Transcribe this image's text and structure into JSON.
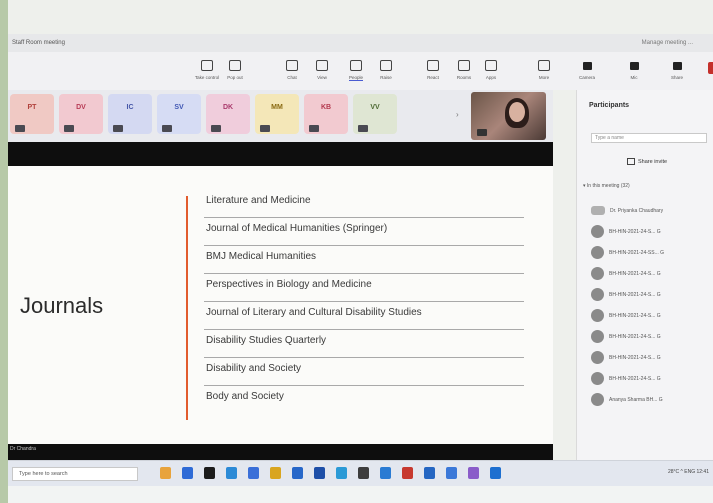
{
  "window": {
    "title": "Staff Room meeting",
    "right_text": "Manage meeting  ..."
  },
  "toolbar": {
    "items": [
      {
        "label": "Take control",
        "icon": "screen-icon"
      },
      {
        "label": "Pop out",
        "icon": "popout-icon"
      },
      {
        "label": "Chat",
        "icon": "chat-icon"
      },
      {
        "label": "View",
        "icon": "view-icon"
      },
      {
        "label": "People",
        "icon": "people-icon",
        "active": true
      },
      {
        "label": "Raise",
        "icon": "hand-icon"
      },
      {
        "label": "React",
        "icon": "react-icon"
      },
      {
        "label": "Rooms",
        "icon": "rooms-icon"
      },
      {
        "label": "Apps",
        "icon": "apps-icon"
      },
      {
        "label": "More",
        "icon": "more-icon"
      }
    ],
    "controls": [
      {
        "label": "Camera",
        "icon": "camera-icon"
      },
      {
        "label": "Mic",
        "icon": "mic-icon"
      },
      {
        "label": "Share",
        "icon": "share-icon"
      }
    ]
  },
  "strip": {
    "tiles": [
      {
        "initials": "PT",
        "bg": "#f0c9c4",
        "fg": "#b0413b"
      },
      {
        "initials": "DV",
        "bg": "#f2c9d0",
        "fg": "#b83b55"
      },
      {
        "initials": "IC",
        "bg": "#d4d9f2",
        "fg": "#4657a8"
      },
      {
        "initials": "SV",
        "bg": "#d6dcf4",
        "fg": "#3f56b3"
      },
      {
        "initials": "DK",
        "bg": "#f0cddc",
        "fg": "#a93a6c"
      },
      {
        "initials": "MM",
        "bg": "#f4e7b8",
        "fg": "#8a6a12"
      },
      {
        "initials": "KB",
        "bg": "#f2cad0",
        "fg": "#b43a4f"
      },
      {
        "initials": "VV",
        "bg": "#dfe6d3",
        "fg": "#4e6a34"
      }
    ]
  },
  "slide": {
    "title": "Journals",
    "journals": [
      "Literature and Medicine",
      "Journal of Medical Humanities (Springer)",
      "BMJ Medical Humanities",
      "Perspectives in Biology and Medicine",
      "Journal of Literary and Cultural Disability Studies",
      "Disability Studies Quarterly",
      "Disability and Society",
      "Body and Society"
    ],
    "presenter_label": "Dr Chandra"
  },
  "panel": {
    "title": "Participants",
    "search_placeholder": "Type a name",
    "share_label": "Share invite",
    "group_label": "In this meeting (32)",
    "participants": [
      "Dr. Priyanka Chaudhary",
      "BH-HIN-2021-24-S... G",
      "BH-HIN-2021-24-SS... G",
      "BH-HIN-2021-24-S... G",
      "BH-HIN-2021-24-S... G",
      "BH-HIN-2021-24-S... G",
      "BH-HIN-2021-24-S... G",
      "BH-HIN-2021-24-S... G",
      "BH-HIN-2021-24-S... G",
      "Ananya Sharma BH... G"
    ]
  },
  "taskbar": {
    "search_placeholder": "Type here to search",
    "tray_text": "28°C  ^  ENG  12:41"
  },
  "colors": {
    "accent": "#4a5bd1",
    "slide_line": "#e25c2e",
    "leave": "#c4302b"
  }
}
